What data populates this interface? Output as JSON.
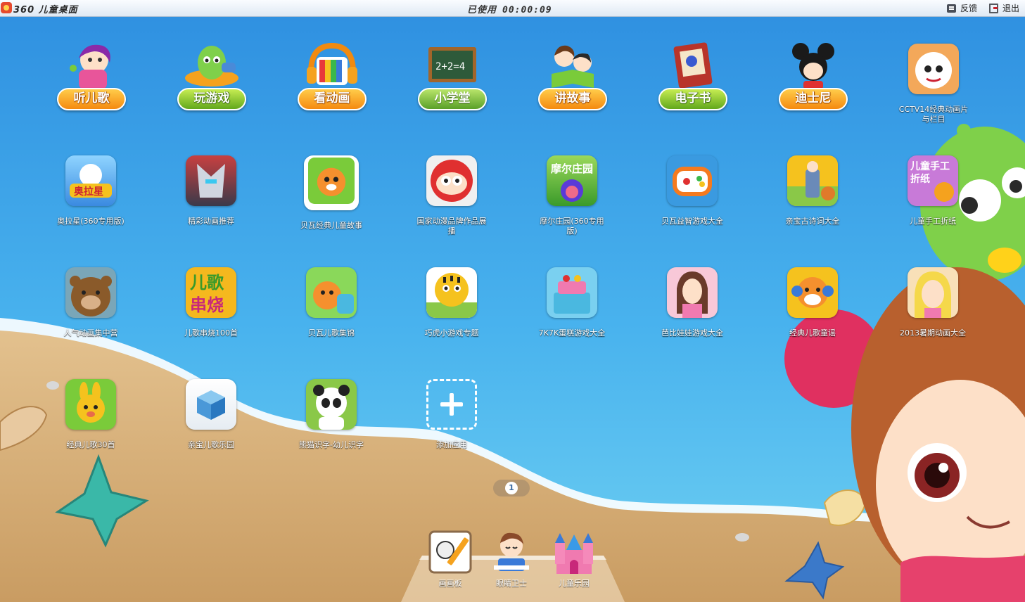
{
  "titlebar": {
    "app_title": "360 儿童桌面",
    "timer_label": "已使用",
    "timer_value": "00:00:09",
    "feedback_label": "反馈",
    "logout_label": "退出"
  },
  "categories": [
    {
      "label": "听儿歌",
      "icon": "singing-girl-icon"
    },
    {
      "label": "玩游戏",
      "icon": "game-alien-icon"
    },
    {
      "label": "看动画",
      "icon": "headphones-tv-icon"
    },
    {
      "label": "小学堂",
      "icon": "chalkboard-icon"
    },
    {
      "label": "讲故事",
      "icon": "reading-kids-icon"
    },
    {
      "label": "电子书",
      "icon": "storybook-icon"
    },
    {
      "label": "迪士尼",
      "icon": "mickey-icon"
    }
  ],
  "apps": [
    {
      "name": "CCTV14经典动画片与栏目",
      "icon": "sheep-icon"
    },
    {
      "name": "奥拉星(360专用版)",
      "icon": "aola-star-icon"
    },
    {
      "name": "精彩动画推荐",
      "icon": "robot-icon"
    },
    {
      "name": "贝瓦经典儿童故事",
      "icon": "beaver-icon"
    },
    {
      "name": "国家动漫品牌作品展播",
      "icon": "hero-mask-icon"
    },
    {
      "name": "摩尔庄园(360专用版)",
      "icon": "mole-icon"
    },
    {
      "name": "贝瓦益智游戏大全",
      "icon": "gamepad-icon"
    },
    {
      "name": "亲宝古诗词大全",
      "icon": "poet-icon"
    },
    {
      "name": "儿童手工折纸",
      "icon": "origami-icon"
    },
    {
      "name": "人气动画集中营",
      "icon": "bear-icon"
    },
    {
      "name": "儿歌串烧100首",
      "icon": "song-medley-icon"
    },
    {
      "name": "贝瓦儿歌集锦",
      "icon": "beaver-song-icon"
    },
    {
      "name": "巧虎小游戏专题",
      "icon": "tiger-icon"
    },
    {
      "name": "7K7K蛋糕游戏大全",
      "icon": "cake-icon"
    },
    {
      "name": "芭比娃娃游戏大全",
      "icon": "doll-icon"
    },
    {
      "name": "经典儿歌童谣",
      "icon": "puppy-headphones-icon"
    },
    {
      "name": "2013暑期动画大全",
      "icon": "anime-girl-icon"
    },
    {
      "name": "经典儿歌30首",
      "icon": "bunny-icon"
    },
    {
      "name": "亲宝儿歌乐园",
      "icon": "cube-icon"
    },
    {
      "name": "熊猫识字-幼儿识字",
      "icon": "panda-icon"
    },
    {
      "name": "添加应用",
      "icon": "add-icon"
    }
  ],
  "pager": {
    "current": "1"
  },
  "dock": [
    {
      "name": "画画板",
      "icon": "drawing-board-icon"
    },
    {
      "name": "眼睛卫士",
      "icon": "eye-guard-icon"
    },
    {
      "name": "儿童乐园",
      "icon": "castle-icon"
    }
  ]
}
